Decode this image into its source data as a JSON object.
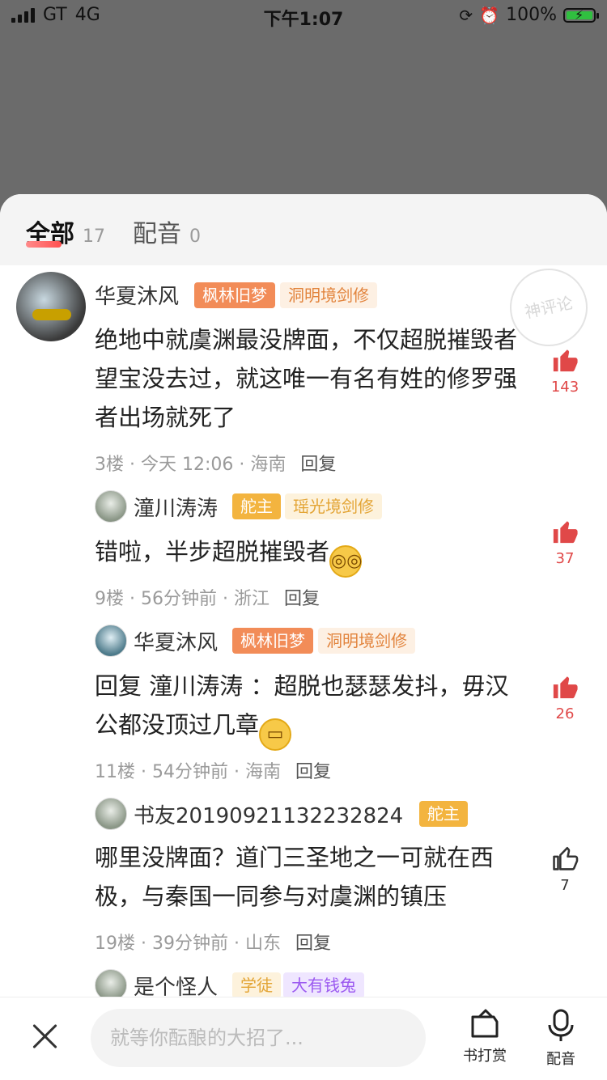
{
  "status": {
    "carrier": "GT",
    "network": "4G",
    "time": "下午1:07",
    "battery": "100%"
  },
  "tabs": [
    {
      "label": "全部",
      "count": "17"
    },
    {
      "label": "配音",
      "count": "0"
    }
  ],
  "stamp_text": "神评论",
  "comments": [
    {
      "name": "华夏沐风",
      "badges": [
        "枫林旧梦",
        "洞明境剑修"
      ],
      "text": "绝地中就虞渊最没牌面，不仅超脱摧毁者望宝没去过，就这唯一有名有姓的修罗强者出场就死了",
      "meta": "3楼 · 今天 12:06 · 海南",
      "reply": "回复",
      "likes": "143"
    },
    {
      "name": "潼川涛涛",
      "badges": [
        "舵主",
        "瑶光境剑修"
      ],
      "text": "错啦，半步超脱摧毁者",
      "meta": "9楼 · 56分钟前 · 浙江",
      "reply": "回复",
      "likes": "37"
    },
    {
      "name": "华夏沐风",
      "badges": [
        "枫林旧梦",
        "洞明境剑修"
      ],
      "text_prefix": "回复",
      "text_mention": "潼川涛涛",
      "text": "：超脱也瑟瑟发抖，毋汉公都没顶过几章",
      "meta": "11楼 · 54分钟前 · 海南",
      "reply": "回复",
      "likes": "26"
    },
    {
      "name": "书友20190921132232824",
      "badges": [
        "舵主"
      ],
      "text": "哪里没牌面？道门三圣地之一可就在西极，与秦国一同参与对虞渊的镇压",
      "meta": "19楼 · 39分钟前 · 山东",
      "reply": "回复",
      "likes": "7"
    },
    {
      "name": "是个怪人",
      "badges": [
        "学徒",
        "大有钱兔"
      ]
    }
  ],
  "bottom": {
    "placeholder": "就等你酝酿的大招了...",
    "reward_label": "书打赏",
    "dub_label": "配音"
  }
}
